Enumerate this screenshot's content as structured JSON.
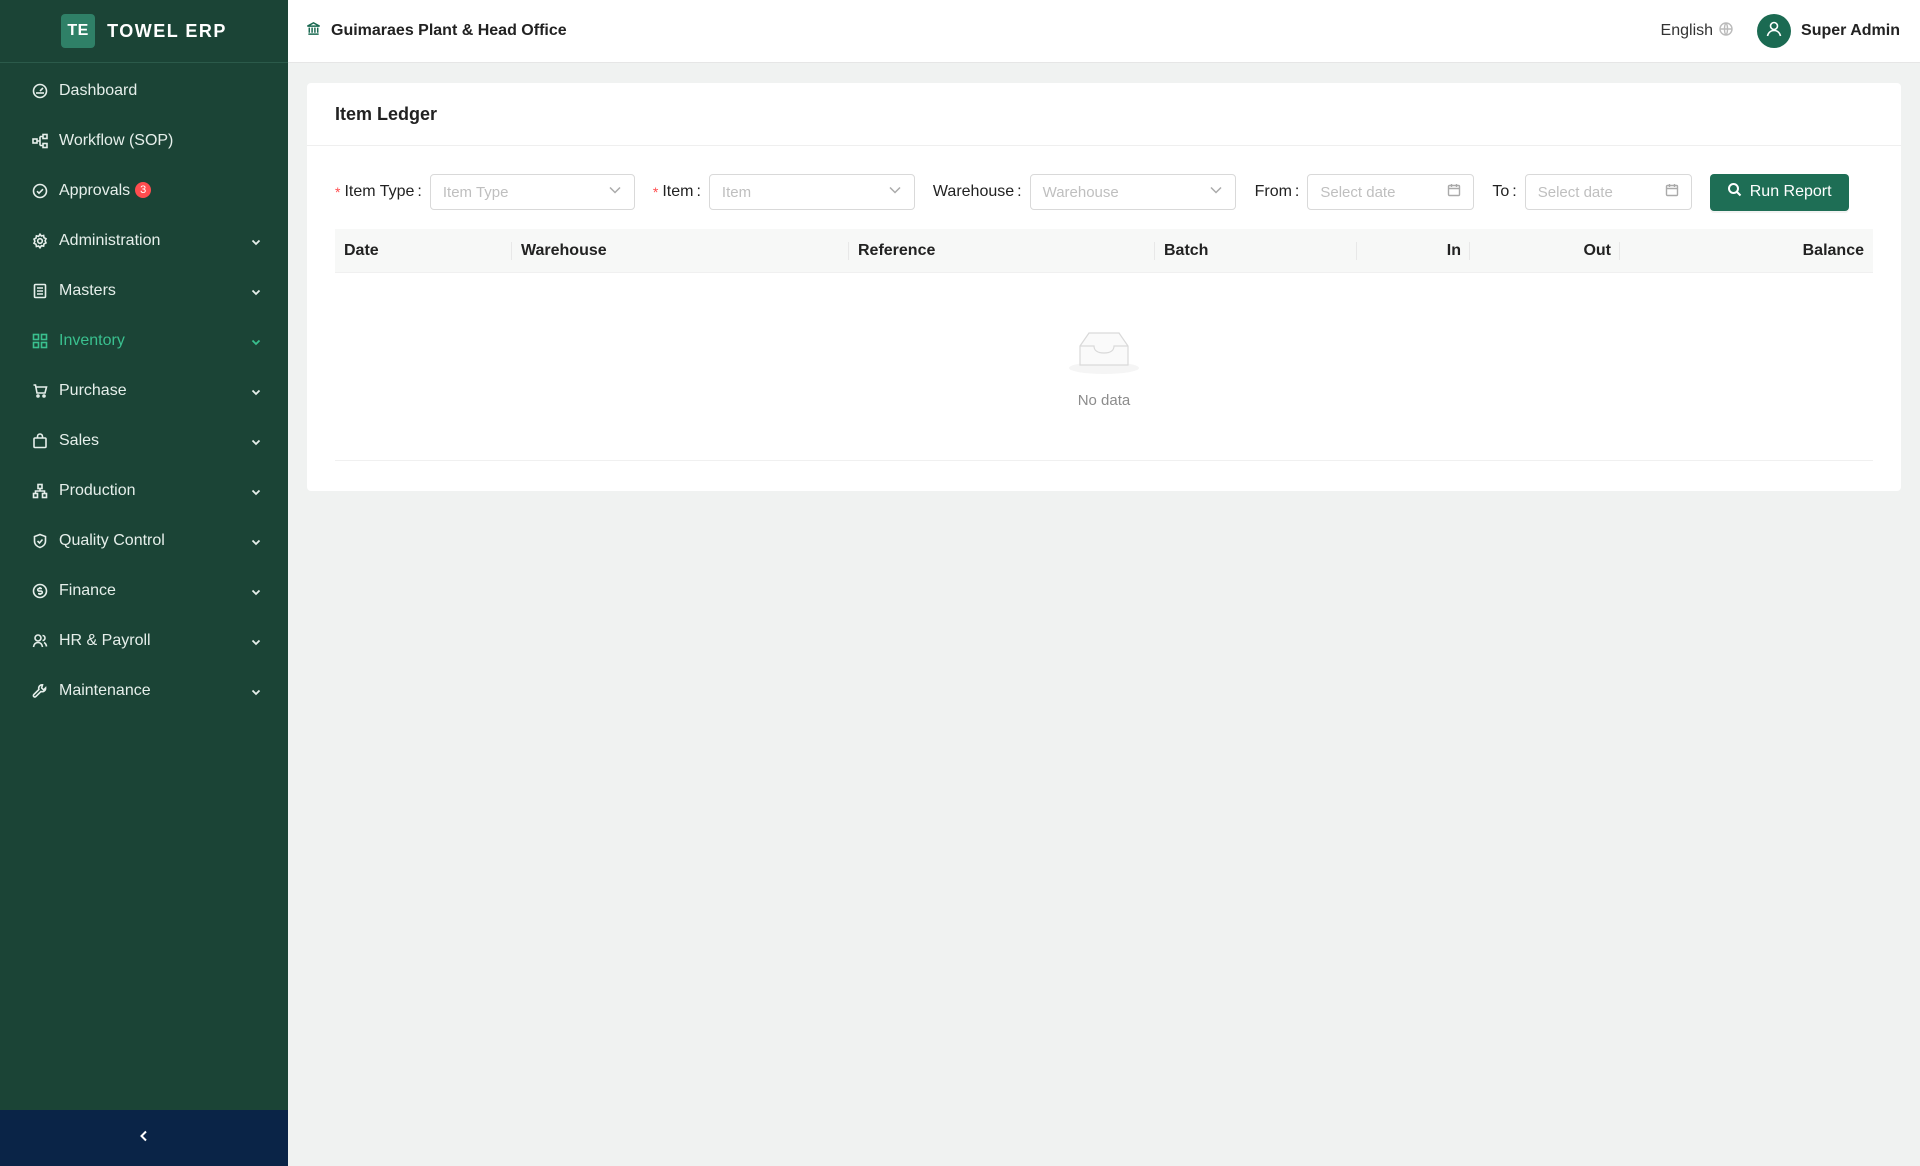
{
  "brand": {
    "logo_text": "TE",
    "name": "TOWEL ERP"
  },
  "sidebar": {
    "items": [
      {
        "label": "Dashboard",
        "icon": "dashboard-icon",
        "has_children": false
      },
      {
        "label": "Workflow (SOP)",
        "icon": "workflow-icon",
        "has_children": false
      },
      {
        "label": "Approvals",
        "icon": "check-circle-icon",
        "has_children": false,
        "badge": "3"
      },
      {
        "label": "Administration",
        "icon": "gear-icon",
        "has_children": true
      },
      {
        "label": "Masters",
        "icon": "book-icon",
        "has_children": true
      },
      {
        "label": "Inventory",
        "icon": "grid-icon",
        "has_children": true,
        "active": true
      },
      {
        "label": "Purchase",
        "icon": "cart-icon",
        "has_children": true
      },
      {
        "label": "Sales",
        "icon": "shopping-bag-icon",
        "has_children": true
      },
      {
        "label": "Production",
        "icon": "cluster-icon",
        "has_children": true
      },
      {
        "label": "Quality Control",
        "icon": "shield-check-icon",
        "has_children": true
      },
      {
        "label": "Finance",
        "icon": "dollar-circle-icon",
        "has_children": true
      },
      {
        "label": "HR & Payroll",
        "icon": "team-icon",
        "has_children": true
      },
      {
        "label": "Maintenance",
        "icon": "tool-icon",
        "has_children": true
      }
    ],
    "collapse_icon": "chevron-left-icon"
  },
  "header": {
    "org_name": "Guimaraes Plant & Head Office",
    "language": "English",
    "user_name": "Super Admin"
  },
  "page": {
    "title": "Item Ledger",
    "filters": {
      "item_type": {
        "label": "Item Type",
        "placeholder": "Item Type",
        "required": true
      },
      "item": {
        "label": "Item",
        "placeholder": "Item",
        "required": true
      },
      "warehouse": {
        "label": "Warehouse",
        "placeholder": "Warehouse",
        "required": false
      },
      "from": {
        "label": "From",
        "placeholder": "Select date"
      },
      "to": {
        "label": "To",
        "placeholder": "Select date"
      }
    },
    "run_button": "Run Report",
    "table": {
      "columns": [
        "Date",
        "Warehouse",
        "Reference",
        "Batch",
        "In",
        "Out",
        "Balance"
      ],
      "rows": [],
      "empty_text": "No data"
    }
  },
  "colors": {
    "sidebar_bg": "#1b4436",
    "active_menu": "#3ac08f",
    "primary_button": "#1e6e55",
    "collapse_bar": "#0a2447",
    "badge": "#ff4d4f"
  }
}
